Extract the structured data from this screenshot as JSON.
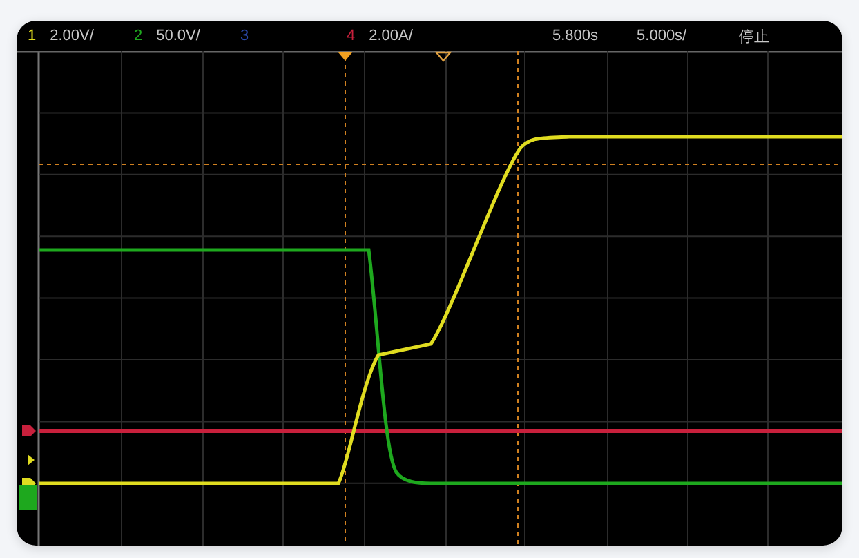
{
  "status_bar": {
    "channels": [
      {
        "number": "1",
        "scale": "2.00V/",
        "color": "#e0dc20"
      },
      {
        "number": "2",
        "scale": "50.0V/",
        "color": "#1ea81e"
      },
      {
        "number": "3",
        "color": "#2a48a8"
      },
      {
        "number": "4",
        "scale": "2.00A/",
        "color": "#c8203c"
      }
    ],
    "delay": "5.800s",
    "timebase": "5.000s/",
    "run_state": "停止"
  }
}
